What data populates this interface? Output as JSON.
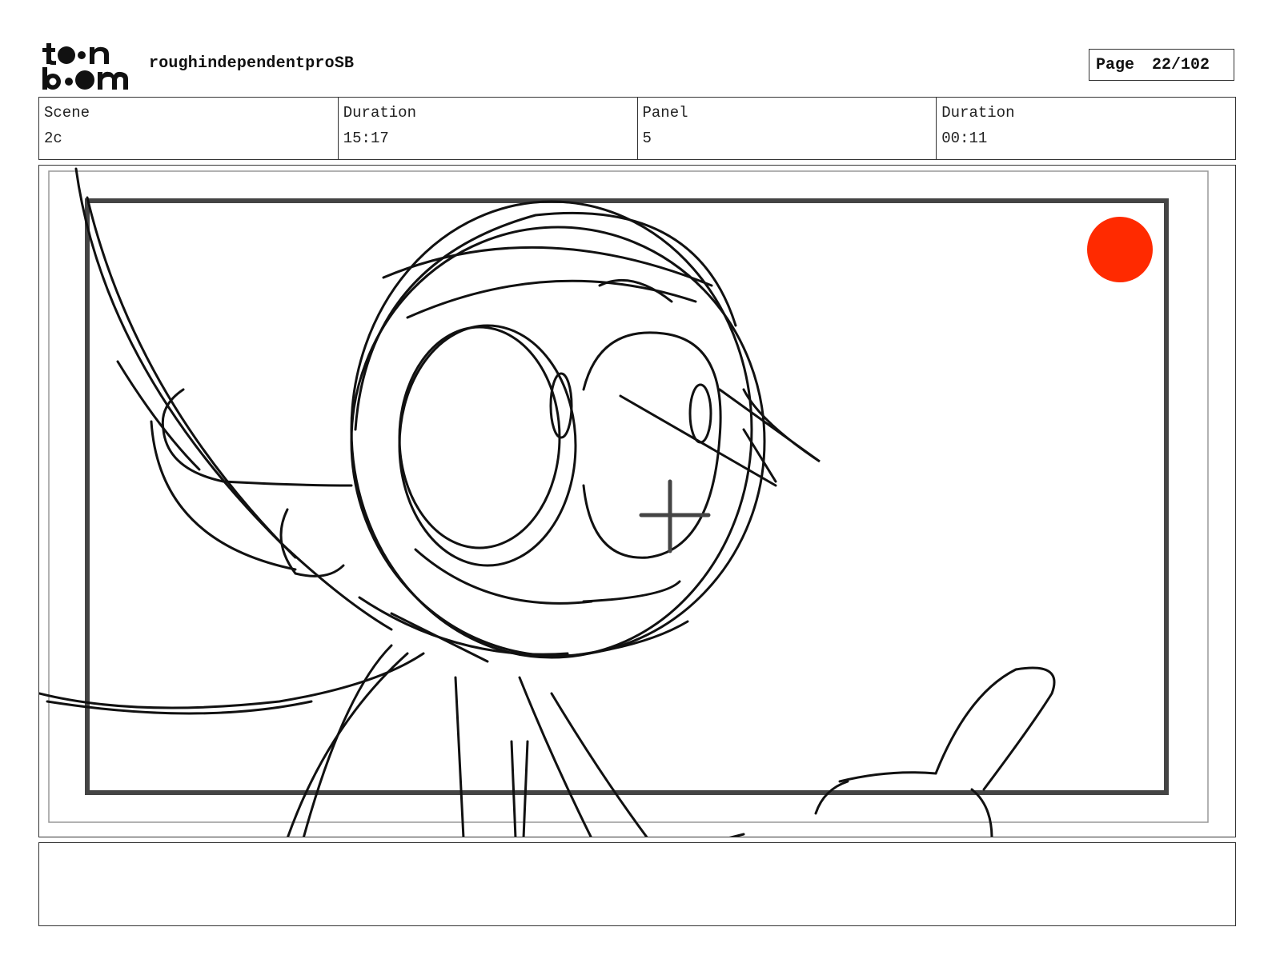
{
  "header": {
    "logo_text": "toon boom",
    "project_title": "roughindependentproSB",
    "page_label": "Page",
    "page_number": "22/102"
  },
  "info": {
    "scene_label": "Scene",
    "scene_value": "2c",
    "scene_duration_label": "Duration",
    "scene_duration_value": "15:17",
    "panel_label": "Panel",
    "panel_value": "5",
    "panel_duration_label": "Duration",
    "panel_duration_value": "00:11"
  },
  "panel": {
    "drawing": "rough storyboard sketch",
    "marker_color": "#ff2a00"
  },
  "notes": {
    "text": ""
  }
}
